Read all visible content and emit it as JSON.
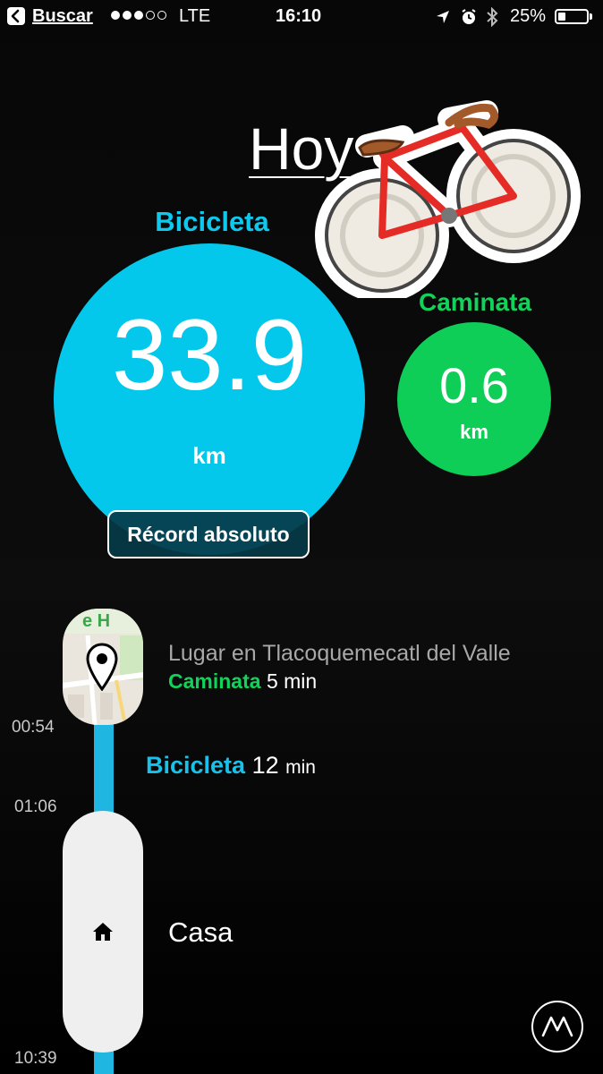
{
  "status_bar": {
    "back_label": "Buscar",
    "signal_bars_filled": 3,
    "signal_bars_total": 5,
    "network": "LTE",
    "time": "16:10",
    "battery_percent": "25%",
    "battery_level": 0.25
  },
  "header": {
    "title": "Hoy"
  },
  "summary": {
    "cycling": {
      "label": "Bicicleta",
      "value": "33.9",
      "unit": "km",
      "badge": "Récord absoluto",
      "color": "#03c8ec"
    },
    "walking": {
      "label": "Caminata",
      "value": "0.6",
      "unit": "km",
      "color": "#0fce57"
    }
  },
  "timeline": {
    "place_visit": {
      "name": "Lugar en Tlacoquemecatl del Valle",
      "activity": "Caminata",
      "duration": "5 min",
      "map_label": "e H"
    },
    "move": {
      "activity": "Bicicleta",
      "duration_value": "12",
      "duration_unit": "min"
    },
    "home": {
      "name": "Casa"
    },
    "times": [
      "00:54",
      "01:06",
      "10:39"
    ]
  },
  "icons": [
    "back-arrow-icon",
    "location-arrow-icon",
    "alarm-clock-icon",
    "bluetooth-icon",
    "bicycle-sticker-icon",
    "map-pin-icon",
    "home-icon",
    "moves-logo-icon"
  ]
}
